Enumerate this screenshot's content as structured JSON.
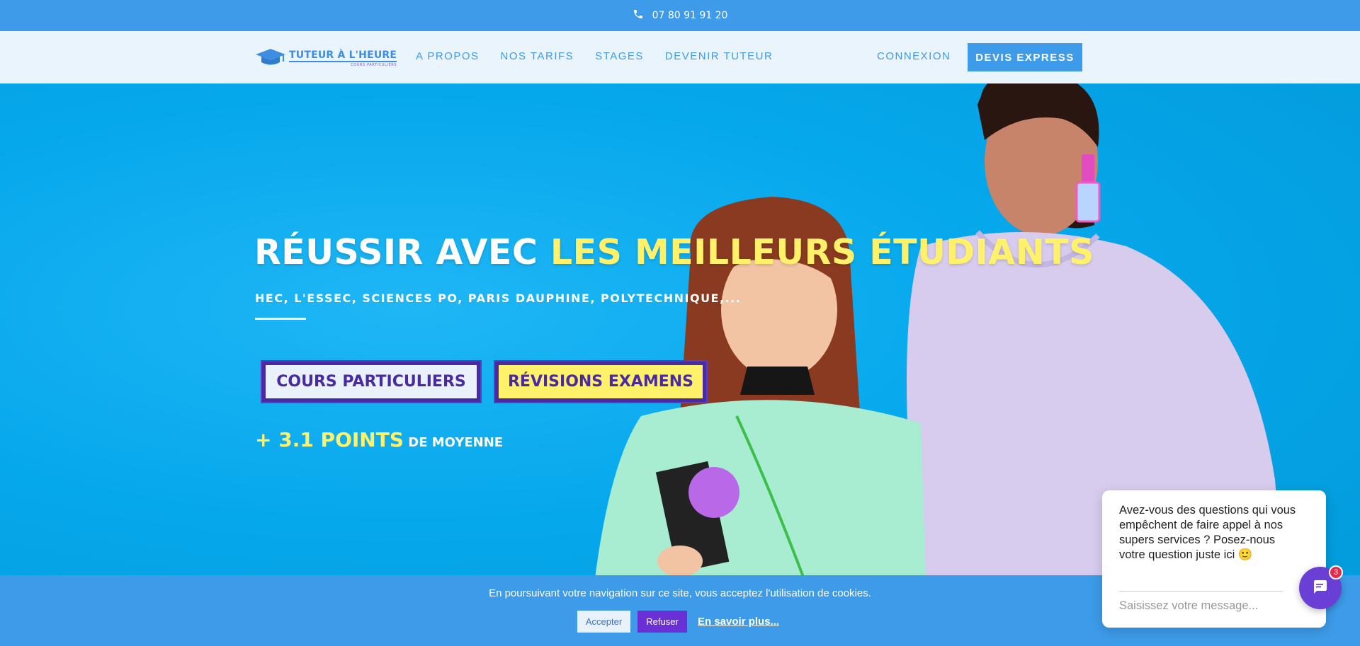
{
  "topbar": {
    "phone": "07 80 91 91 20",
    "icon": "phone-icon"
  },
  "nav": {
    "logo_title": "TUTEUR À L'HEURE",
    "logo_subtitle": "COURS PARTICULIERS",
    "links": [
      "A PROPOS",
      "NOS TARIFS",
      "STAGES",
      "DEVENIR TUTEUR"
    ],
    "login": "CONNEXION",
    "cta": "DEVIS EXPRESS"
  },
  "hero": {
    "headline_part1": "RÉUSSIR AVEC ",
    "headline_highlight": "LES MEILLEURS ÉTUDIANTS",
    "subline": "HEC, L'ESSEC, SCIENCES PO, PARIS DAUPHINE, POLYTECHNIQUE,...",
    "btn_cours": "COURS PARTICULIERS",
    "btn_revisions": "RÉVISIONS EXAMENS",
    "points_big": "+ 3.1 POINTS",
    "points_small": " DE MOYENNE"
  },
  "cookie": {
    "text": "En poursuivant votre navigation sur ce site, vous acceptez l'utilisation de cookies.",
    "accept": "Accepter",
    "refuse": "Refuser",
    "learn_more": "En savoir plus..."
  },
  "chat": {
    "message": "Avez-vous des questions qui vous empêchent de faire appel à nos supers services ? Posez-nous votre question juste ici 🙂",
    "placeholder": "Saisissez votre message...",
    "badge": "3"
  },
  "colors": {
    "brand_blue": "#3d9be9",
    "hero_bg": "#06a8ec",
    "highlight_yellow": "#fff26a",
    "purple": "#4a2aa0",
    "chat_purple": "#6a3fd6"
  }
}
